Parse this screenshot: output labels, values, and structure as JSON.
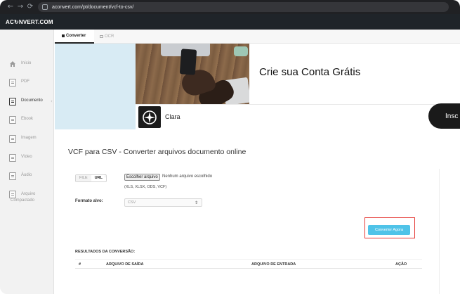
{
  "browser": {
    "url": "aconvert.com/pt/document/vcf-to-csv/",
    "back_icon": "arrow-left-icon",
    "forward_icon": "arrow-right-icon",
    "reload_icon": "reload-icon"
  },
  "site": {
    "logo": "AC↻NVERT.COM"
  },
  "sidebar": {
    "items": [
      {
        "label": "Início",
        "icon": "home-icon"
      },
      {
        "label": "PDF",
        "icon": "pdf-icon"
      },
      {
        "label": "Documento",
        "icon": "document-icon",
        "active": true
      },
      {
        "label": "Ebook",
        "icon": "ebook-icon"
      },
      {
        "label": "Imagem",
        "icon": "image-icon"
      },
      {
        "label": "Vídeo",
        "icon": "video-icon"
      },
      {
        "label": "Áudio",
        "icon": "audio-icon"
      },
      {
        "label": "Arquivo",
        "label2": "Compactado",
        "icon": "archive-icon"
      }
    ]
  },
  "tabs": {
    "converter": "Converter",
    "ocr": "OCR"
  },
  "ad": {
    "headline": "Crie sua Conta Grátis",
    "brand": "Clara",
    "cta": "Insc"
  },
  "main": {
    "title": "VCF para CSV - Converter arquivos documento online",
    "toggle_file": "FILE",
    "toggle_url": "URL",
    "toggle_colon": ":",
    "choose_button": "Escolher arquivo",
    "no_file": "Nenhum arquivo escolhido",
    "formats_hint": "(XLS, XLSX, ODS, VCF)",
    "target_label": "Formato alvo:",
    "target_value": "CSV",
    "convert_button": "Converter Agora",
    "results_label": "RESULTADOS DA CONVERSÃO:",
    "columns": {
      "num": "#",
      "output": "ARQUIVO DE SAÍDA",
      "input": "ARQUIVO DE ENTRADA",
      "action": "AÇÃO"
    }
  },
  "colors": {
    "header_bg": "#1f2429",
    "convert_button": "#4fc3e8",
    "highlight": "#e53935",
    "ad_panel": "#d8ebf4"
  }
}
